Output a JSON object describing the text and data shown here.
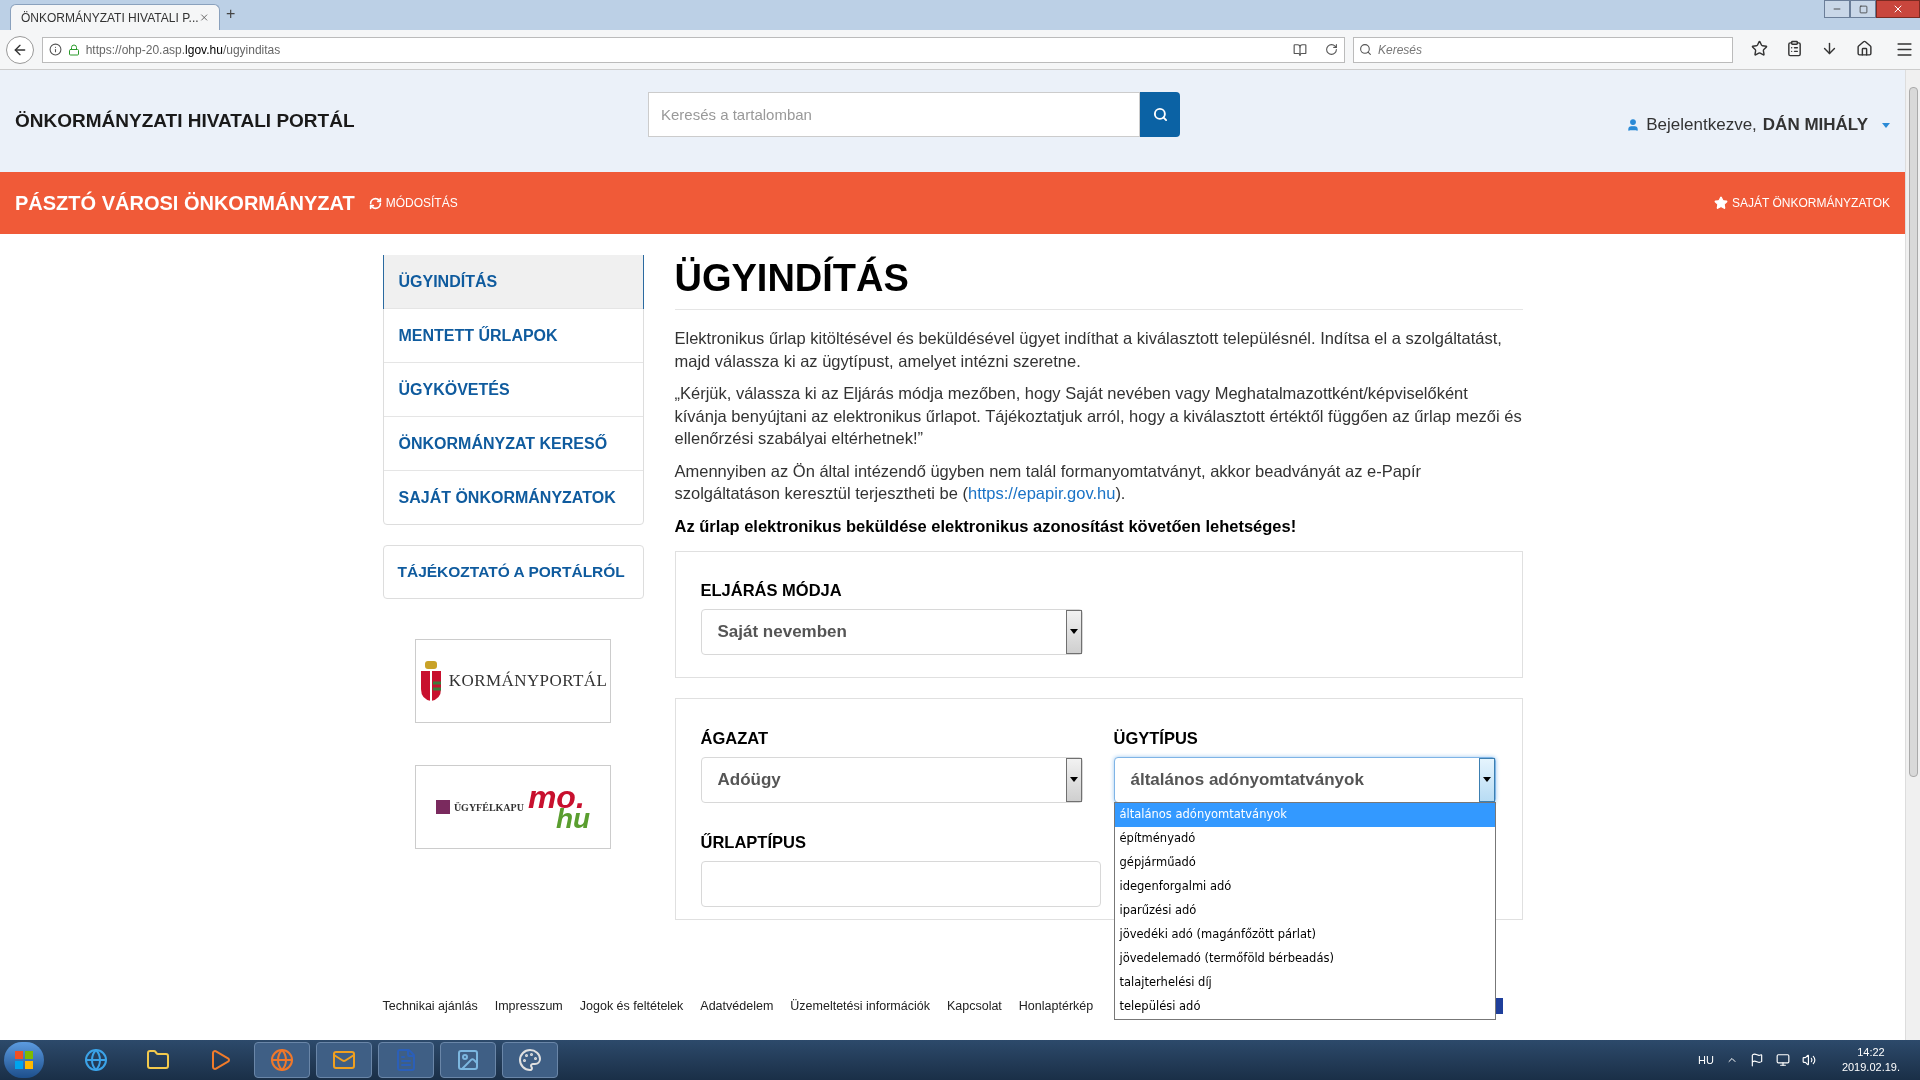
{
  "browser": {
    "tab_title": "ÖNKORMÁNYZATI HIVATALI P...",
    "new_tab": "+",
    "url_host": "https://ohp-20.asp.",
    "url_domain": "lgov.hu",
    "url_path": "/ugyinditas",
    "search_placeholder": "Keresés"
  },
  "header": {
    "title": "ÖNKORMÁNYZATI HIVATALI PORTÁL",
    "search_placeholder": "Keresés a tartalomban",
    "user_prefix": "Bejelentkezve,",
    "user_name": "DÁN MIHÁLY"
  },
  "municipality_bar": {
    "name": "PÁSZTÓ VÁROSI ÖNKORMÁNYZAT",
    "modify": "MÓDOSÍTÁS",
    "own": "SAJÁT ÖNKORMÁNYZATOK"
  },
  "sidebar": {
    "items": [
      {
        "label": "ÜGYINDÍTÁS",
        "selected": true
      },
      {
        "label": "MENTETT ŰRLAPOK",
        "selected": false
      },
      {
        "label": "ÜGYKÖVETÉS",
        "selected": false
      },
      {
        "label": "ÖNKORMÁNYZAT KERESŐ",
        "selected": false
      },
      {
        "label": "SAJÁT ÖNKORMÁNYZATOK",
        "selected": false
      }
    ],
    "info_link": "TÁJÉKOZTATÓ A PORTÁLRÓL",
    "logos": [
      {
        "kind": "kormanyportal",
        "text": "KORMÁNYPORTÁL"
      },
      {
        "kind": "ugyfelkapu",
        "text": "ÜGYFÉLKAPU",
        "mark_1": "mo.",
        "mark_2": "hu"
      }
    ]
  },
  "content": {
    "title": "ÜGYINDÍTÁS",
    "paragraphs": [
      "Elektronikus űrlap kitöltésével és beküldésével ügyet indíthat a kiválasztott településnél. Indítsa el a szolgáltatást, majd válassza ki az ügytípust, amelyet intézni szeretne.",
      "„Kérjük, válassza ki az Eljárás módja mezőben, hogy Saját nevében vagy Meghatalmazottként/képviselőként kívánja benyújtani az elektronikus űrlapot. Tájékoztatjuk arról, hogy a kiválasztott értéktől függően az űrlap mezői és ellenőrzési szabályai eltérhetnek!”"
    ],
    "epapir": {
      "before": "Amennyiben az Ön által intézendő ügyben nem talál formanyomtatványt, akkor beadványát az e-Papír szolgáltatáson keresztül terjesztheti be (",
      "link": "https://epapir.gov.hu",
      "after": ")."
    },
    "notice": "Az űrlap elektronikus beküldése elektronikus azonosítást követően lehetséges!"
  },
  "forms": {
    "procedure": {
      "label": "ELJÁRÁS MÓDJA",
      "value": "Saját nevemben"
    },
    "sector": {
      "label": "ÁGAZAT",
      "value": "Adóügy"
    },
    "case_type": {
      "label": "ÜGYTÍPUS",
      "value": "általános adónyomtatványok",
      "expanded": true,
      "options": [
        {
          "label": "általános adónyomtatványok",
          "selected": true
        },
        {
          "label": "építményadó",
          "selected": false
        },
        {
          "label": "gépjárműadó",
          "selected": false
        },
        {
          "label": "idegenforgalmi adó",
          "selected": false
        },
        {
          "label": "iparűzési adó",
          "selected": false
        },
        {
          "label": "jövedéki adó (magánfőzött párlat)",
          "selected": false
        },
        {
          "label": "jövedelemadó (termőföld bérbeadás)",
          "selected": false
        },
        {
          "label": "talajterhelési díj",
          "selected": false
        },
        {
          "label": "települési adó",
          "selected": false
        }
      ]
    },
    "form_type": {
      "label": "ŰRLAPTÍPUS"
    }
  },
  "footer": {
    "links": [
      "Technikai ajánlás",
      "Impresszum",
      "Jogok és feltételek",
      "Adatvédelem",
      "Üzemeltetési információk",
      "Kapcsolat",
      "Honlaptérkép"
    ]
  },
  "taskbar": {
    "language": "HU",
    "time": "14:22",
    "date": "2019.02.19."
  }
}
